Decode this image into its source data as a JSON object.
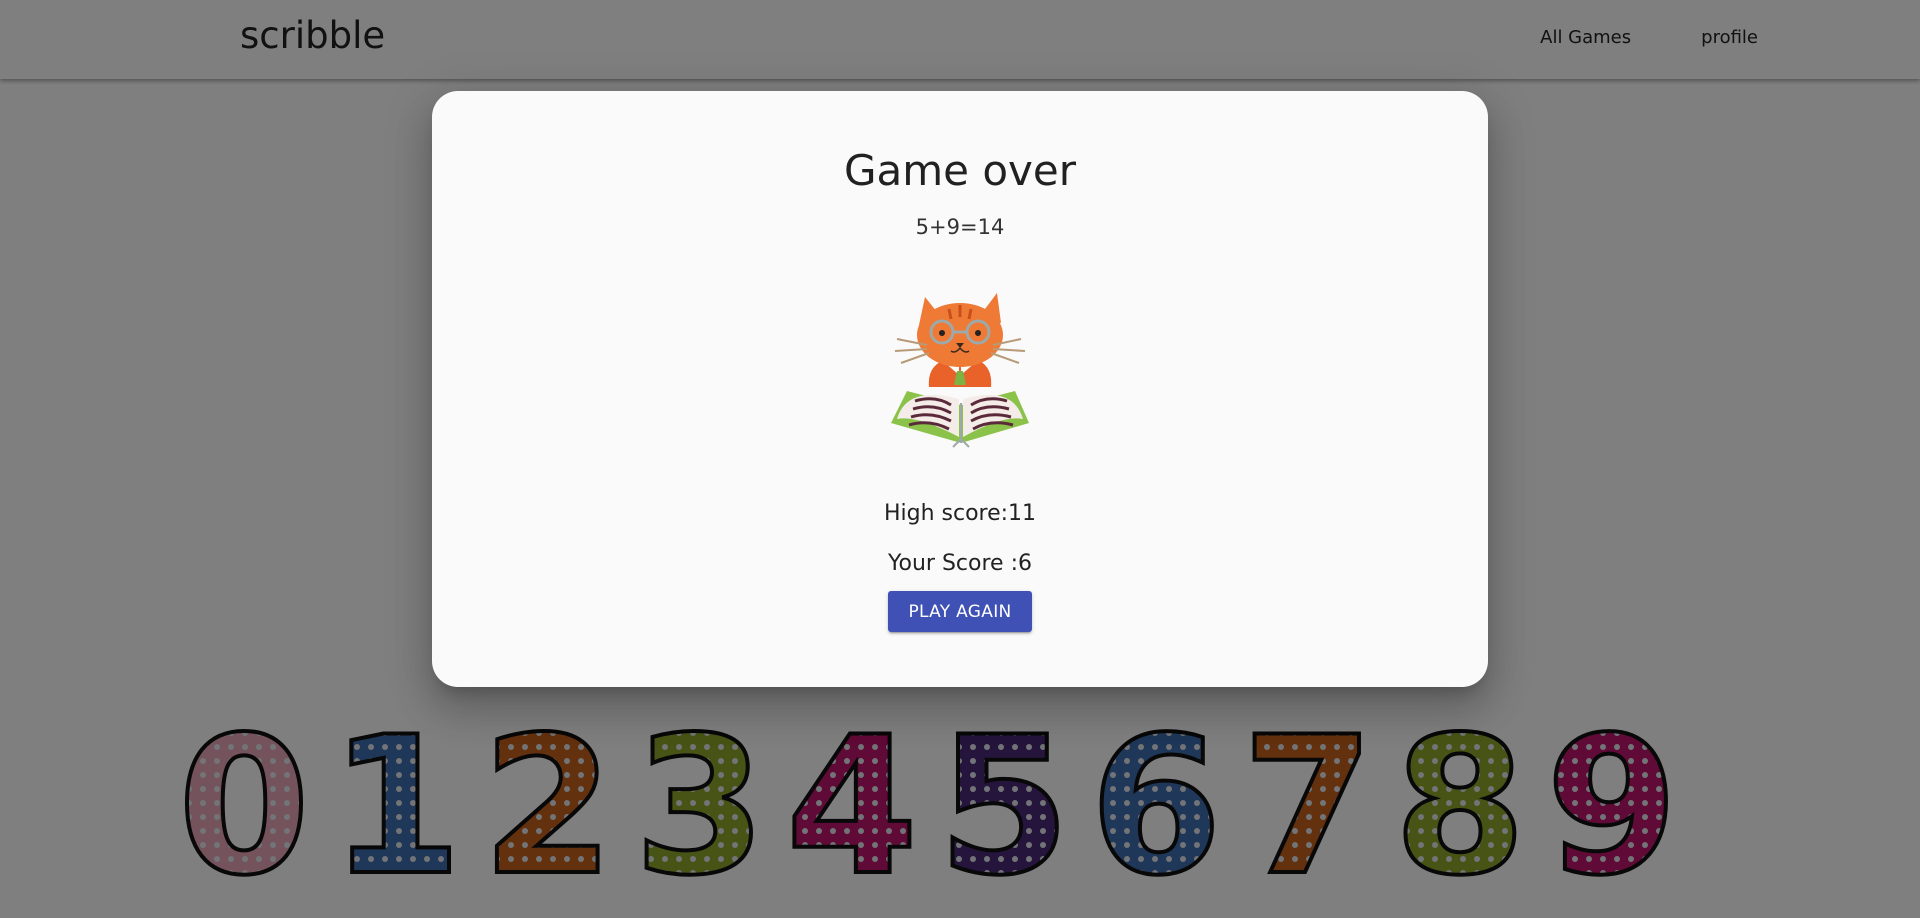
{
  "navbar": {
    "brand": "scribble",
    "links": [
      {
        "label": "All Games"
      },
      {
        "label": "profile"
      }
    ]
  },
  "background": {
    "digits": [
      "0",
      "1",
      "2",
      "3",
      "4",
      "5",
      "6",
      "7",
      "8",
      "9"
    ],
    "digit_colors": [
      "#e8a6b8",
      "#3f6fb0",
      "#c8621c",
      "#8fa82a",
      "#c0156e",
      "#4b2a7a",
      "#3f6fb0",
      "#c8621c",
      "#8fa82a",
      "#c0156e"
    ]
  },
  "modal": {
    "title": "Game over",
    "equation": "5+9=14",
    "illustration": "cat-reading-book-icon",
    "high_score": "High score:11",
    "your_score": "Your Score :6",
    "button_label": "PLAY AGAIN"
  },
  "colors": {
    "accent": "#3f51b5",
    "backdrop": "rgba(0,0,0,0.5)",
    "modal_bg": "#fafafa"
  }
}
